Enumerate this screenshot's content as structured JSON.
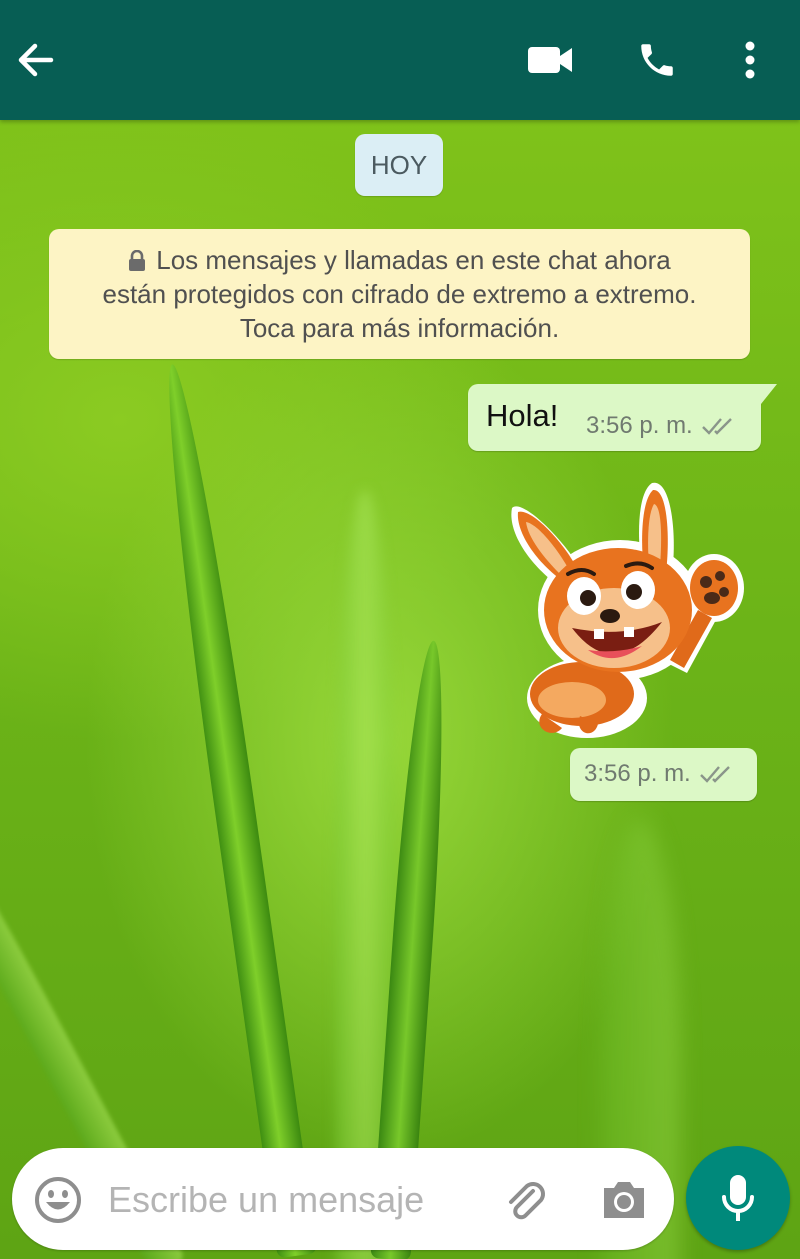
{
  "header": {
    "back_icon": "arrow-left-icon",
    "video_call_icon": "video-camera-icon",
    "voice_call_icon": "phone-icon",
    "menu_icon": "more-vertical-icon",
    "color": "#075e54"
  },
  "chat": {
    "date_chip": "HOY",
    "encryption_notice": {
      "icon": "lock-icon",
      "line1": "Los mensajes y llamadas en este chat ahora",
      "line2": "están protegidos con cifrado de extremo a extremo.",
      "line3": "Toca para más información."
    },
    "messages": [
      {
        "type": "text",
        "text": "Hola!",
        "time": "3:56 p. m.",
        "status": "read-double-check-icon"
      },
      {
        "type": "sticker",
        "sticker": "fox-waving-sticker",
        "time": "3:56 p. m.",
        "status": "read-double-check-icon"
      }
    ],
    "outgoing_bubble_color": "#dcf8c6"
  },
  "composer": {
    "emoji_icon": "emoji-icon",
    "placeholder": "Escribe un mensaje",
    "attach_icon": "paperclip-icon",
    "camera_icon": "camera-icon",
    "mic_icon": "microphone-icon",
    "mic_color": "#00897b"
  }
}
